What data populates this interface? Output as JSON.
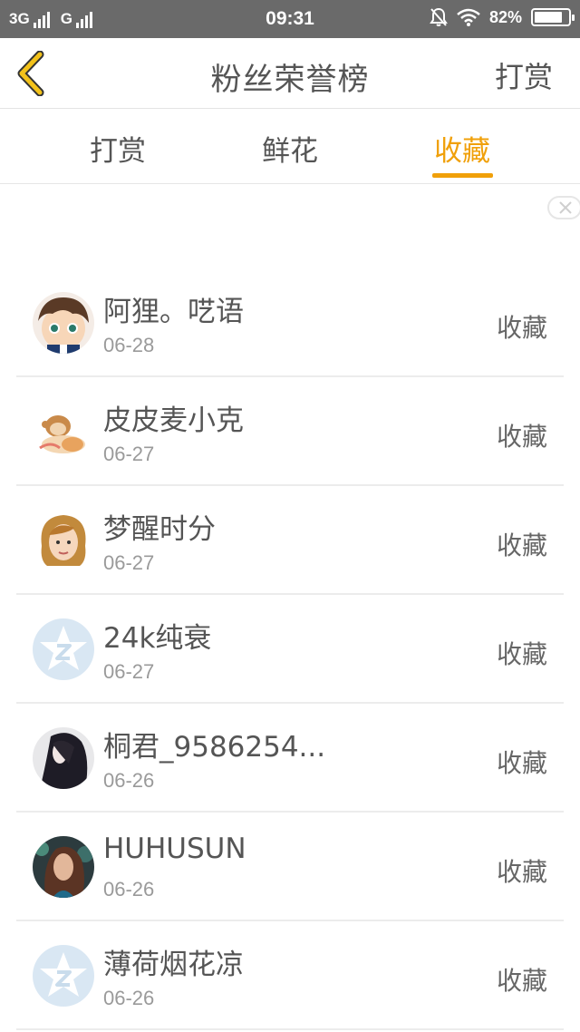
{
  "status_bar": {
    "network_1": "3G",
    "network_2": "G",
    "time": "09:31",
    "battery": "82%",
    "battery_level": 0.82
  },
  "header": {
    "title": "粉丝荣誉榜",
    "right_action": "打赏",
    "back_icon": "chevron-left-icon",
    "accent_color": "#f0a00a"
  },
  "tabs": [
    {
      "label": "打赏",
      "active": false
    },
    {
      "label": "鲜花",
      "active": false
    },
    {
      "label": "收藏",
      "active": true
    }
  ],
  "list": [
    {
      "name": "阿狸。呓语",
      "date": "06-28",
      "tag": "收藏",
      "avatar": "boy-cartoon-avatar"
    },
    {
      "name": "皮皮麦小克",
      "date": "06-27",
      "tag": "收藏",
      "avatar": "monkey-cartoon-avatar"
    },
    {
      "name": "梦醒时分",
      "date": "06-27",
      "tag": "收藏",
      "avatar": "girl-cartoon-avatar"
    },
    {
      "name": "24k纯衰",
      "date": "06-27",
      "tag": "收藏",
      "avatar": "default-star-avatar"
    },
    {
      "name": "桐君_9586254...",
      "date": "06-26",
      "tag": "收藏",
      "avatar": "dark-portrait-avatar"
    },
    {
      "name": "HUHUSUN",
      "date": "06-26",
      "tag": "收藏",
      "avatar": "woman-photo-avatar"
    },
    {
      "name": "薄荷烟花凉",
      "date": "06-26",
      "tag": "收藏",
      "avatar": "default-star-avatar"
    }
  ]
}
